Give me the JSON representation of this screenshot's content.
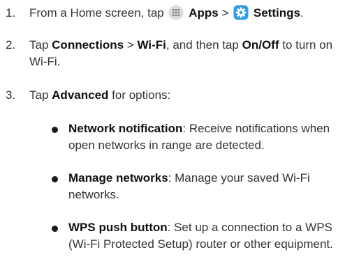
{
  "steps": [
    {
      "num": "1.",
      "t1": "From a Home screen, tap",
      "apps_label": "Apps",
      "sep": ">",
      "settings_label": "Settings",
      "end": "."
    },
    {
      "num": "2.",
      "t1": "Tap",
      "connections": "Connections",
      "sep": ">",
      "wifi": "Wi-Fi",
      "t2": ", and then tap",
      "onoff": "On/Off",
      "t3": "to turn on Wi-Fi."
    },
    {
      "num": "3.",
      "t1": "Tap",
      "advanced": "Advanced",
      "t2": "for options:"
    }
  ],
  "bullets": [
    {
      "term": "Network notification",
      "desc": ": Receive notifications when open networks in range are detected."
    },
    {
      "term": "Manage networks",
      "desc": ": Manage your saved Wi-Fi networks."
    },
    {
      "term": "WPS push button",
      "desc": ": Set up a connection to a WPS (Wi-Fi Protected Setup) router or other equipment."
    }
  ],
  "icons": {
    "apps": "apps-grid-icon",
    "settings": "settings-gear-icon",
    "apps_bg": "#dcdcdc",
    "settings_bg": "#2c9be0"
  }
}
